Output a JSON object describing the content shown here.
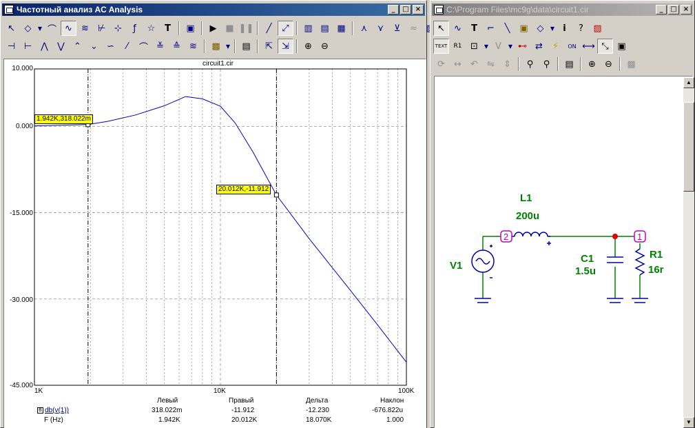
{
  "analysis_window": {
    "title": "Частотный анализ AC Analysis",
    "plot_title": "circuit1.cir",
    "y_ticks": [
      "10.000",
      "0.000",
      "-15.000",
      "-30.000",
      "-45.000"
    ],
    "x_ticks": [
      "1K",
      "10K",
      "100K"
    ],
    "cursor_left_label": "1.942K,318.022m",
    "cursor_right_label": "20.012K,-11.912",
    "table": {
      "headers": [
        "Левый",
        "Правый",
        "Дельта",
        "Наклон"
      ],
      "row1_name": "db(v(1))",
      "row1": [
        "318.022m",
        "-11.912",
        "-12.230",
        "-676.822u"
      ],
      "row2_name": "F (Hz)",
      "row2": [
        "1.942K",
        "20.012K",
        "18.070K",
        "1.000"
      ]
    },
    "colors": {
      "trace": "#0000c0",
      "grid": "#808080"
    }
  },
  "chart_data": {
    "type": "line",
    "title": "circuit1.cir",
    "xlabel": "",
    "ylabel": "",
    "xscale": "log",
    "xlim": [
      1000,
      100000
    ],
    "ylim": [
      -45,
      10
    ],
    "series": [
      {
        "name": "db(v(1))",
        "x": [
          1000,
          1942,
          2500,
          3500,
          5000,
          6500,
          8000,
          10000,
          12000,
          15000,
          20012,
          30000,
          50000,
          70000,
          100000
        ],
        "y": [
          0.1,
          0.32,
          0.9,
          2.0,
          3.6,
          5.2,
          4.8,
          3.5,
          0.6,
          -4.5,
          -11.912,
          -19.5,
          -28.5,
          -34.5,
          -41.0
        ]
      }
    ],
    "cursors": [
      {
        "x": 1942,
        "y": 0.318
      },
      {
        "x": 20012,
        "y": -11.912
      }
    ]
  },
  "schematic_window": {
    "title": "C:\\Program Files\\mc9g\\data\\circuit1.cir",
    "components": {
      "L1": {
        "name": "L1",
        "value": "200u"
      },
      "C1": {
        "name": "C1",
        "value": "1.5u"
      },
      "R1": {
        "name": "R1",
        "value": "16r"
      },
      "V1": {
        "name": "V1"
      }
    },
    "nodes": [
      "2",
      "1"
    ],
    "colors": {
      "wire": "#008000",
      "part": "#0000a0",
      "node": "#c000c0",
      "label": "#008000"
    }
  }
}
